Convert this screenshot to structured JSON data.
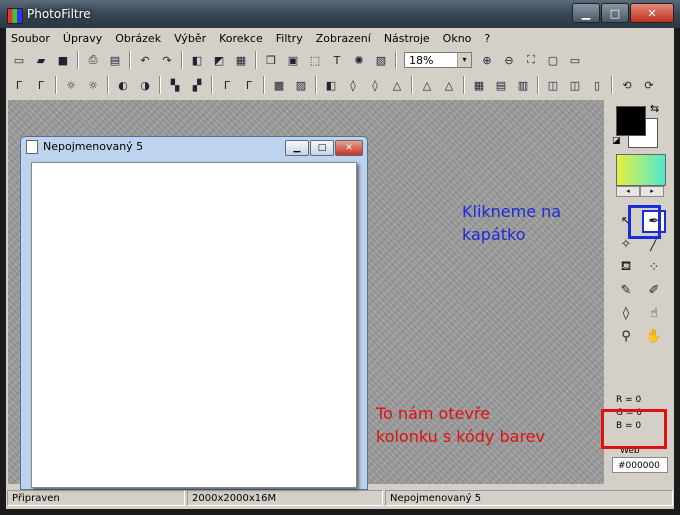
{
  "window": {
    "title": "PhotoFiltre",
    "buttons": {
      "minimize": "▁",
      "maximize": "□",
      "close": "✕"
    }
  },
  "menu": [
    "Soubor",
    "Úpravy",
    "Obrázek",
    "Výběr",
    "Korekce",
    "Filtry",
    "Zobrazení",
    "Nástroje",
    "Okno",
    "?"
  ],
  "toolbar": {
    "zoom_value": "18%",
    "zoom_arrow": "▾"
  },
  "document": {
    "title": "Nepojmenovaný 5",
    "buttons": {
      "minimize": "▁",
      "maximize": "□",
      "close": "✕"
    }
  },
  "annotations": {
    "note1": [
      "Klikneme na",
      "kapátko"
    ],
    "note2": [
      "To nám otevře",
      "kolonku s kódy barev"
    ]
  },
  "tool_panel": {
    "rgb": {
      "r": "R = 0",
      "g": "G = 0",
      "b": "B = 0"
    },
    "web_label": "Web",
    "web_value": "#000000",
    "foreground_color": "#000000",
    "background_color": "#ffffff"
  },
  "status": {
    "state": "Připraven",
    "dimensions": "2000x2000x16M",
    "doc_name": "Nepojmenovaný 5"
  },
  "colors": {
    "annotation_blue": "#1b2bd6",
    "annotation_red": "#e01010"
  }
}
